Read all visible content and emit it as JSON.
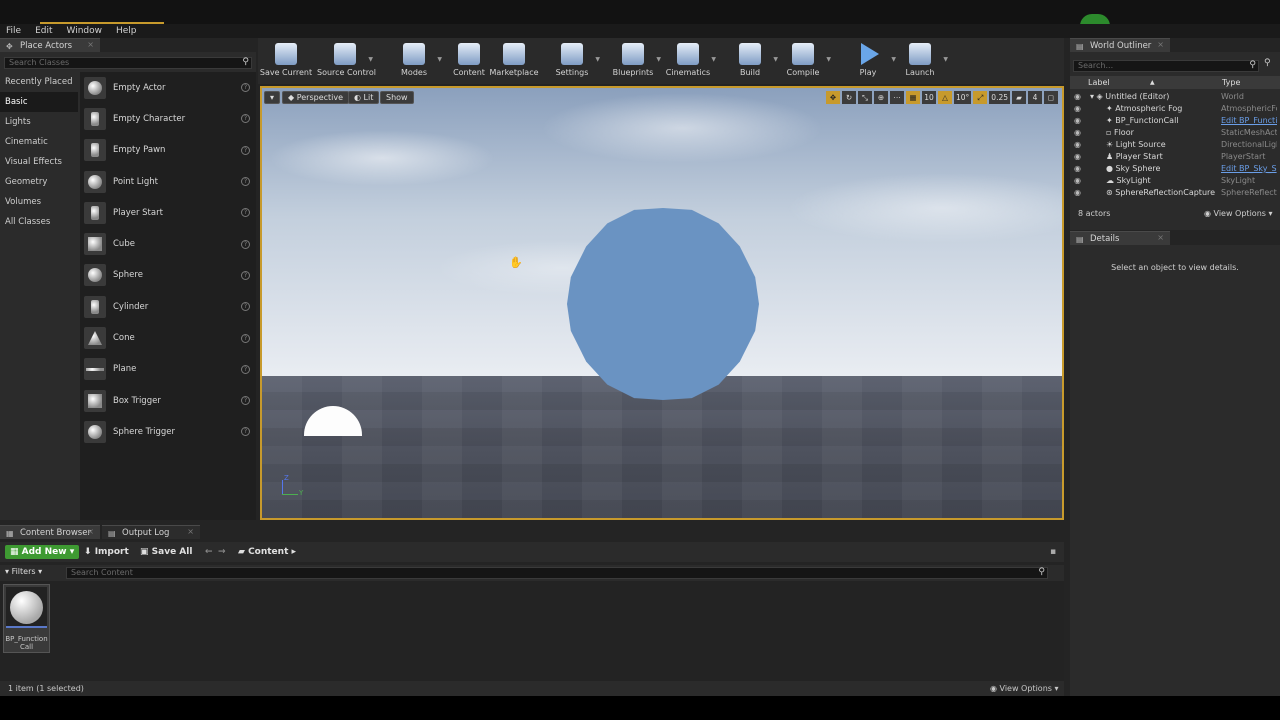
{
  "menu": [
    "File",
    "Edit",
    "Window",
    "Help"
  ],
  "place_actors": {
    "tab": "Place Actors",
    "search_placeholder": "Search Classes",
    "categories": [
      "Recently Placed",
      "Basic",
      "Lights",
      "Cinematic",
      "Visual Effects",
      "Geometry",
      "Volumes",
      "All Classes"
    ],
    "selected_category": "Basic",
    "actors": [
      "Empty Actor",
      "Empty Character",
      "Empty Pawn",
      "Point Light",
      "Player Start",
      "Cube",
      "Sphere",
      "Cylinder",
      "Cone",
      "Plane",
      "Box Trigger",
      "Sphere Trigger"
    ]
  },
  "toolbar": [
    "Save Current",
    "Source Control",
    "Modes",
    "Content",
    "Marketplace",
    "Settings",
    "Blueprints",
    "Cinematics",
    "Build",
    "Compile",
    "Play",
    "Launch"
  ],
  "viewport": {
    "perspective": "Perspective",
    "lit": "Lit",
    "show": "Show",
    "grid_snap": "10",
    "rotation_snap": "10°",
    "scale_snap": "0.25",
    "camera_speed": "4",
    "axis_x": "Y",
    "axis_z": "Z"
  },
  "outliner": {
    "tab": "World Outliner",
    "search_placeholder": "Search...",
    "col_label": "Label",
    "col_type": "Type",
    "rows": [
      {
        "name": "Untitled (Editor)",
        "type": "World",
        "link": false
      },
      {
        "name": "Atmospheric Fog",
        "type": "AtmosphericFo",
        "link": false
      },
      {
        "name": "BP_FunctionCall",
        "type": "Edit BP_Functi",
        "link": true
      },
      {
        "name": "Floor",
        "type": "StaticMeshActo",
        "link": false
      },
      {
        "name": "Light Source",
        "type": "DirectionalLigh",
        "link": false
      },
      {
        "name": "Player Start",
        "type": "PlayerStart",
        "link": false
      },
      {
        "name": "Sky Sphere",
        "type": "Edit BP_Sky_S",
        "link": true
      },
      {
        "name": "SkyLight",
        "type": "SkyLight",
        "link": false
      },
      {
        "name": "SphereReflectionCapture",
        "type": "SphereReflecti",
        "link": false
      }
    ],
    "count": "8 actors",
    "view_options": "View Options"
  },
  "details": {
    "tab": "Details",
    "message": "Select an object to view details."
  },
  "content": {
    "tab_browser": "Content Browser",
    "tab_log": "Output Log",
    "add_new": "Add New",
    "import": "Import",
    "save_all": "Save All",
    "path": "Content",
    "filters": "Filters",
    "search_placeholder": "Search Content",
    "asset_name": "BP_Function Call",
    "status": "1 item (1 selected)",
    "view_options": "View Options"
  },
  "colors": {
    "accent": "#c79a2c",
    "add_new": "#3e9a32",
    "sphere": "#6a93c2",
    "link": "#6a9ee8"
  }
}
